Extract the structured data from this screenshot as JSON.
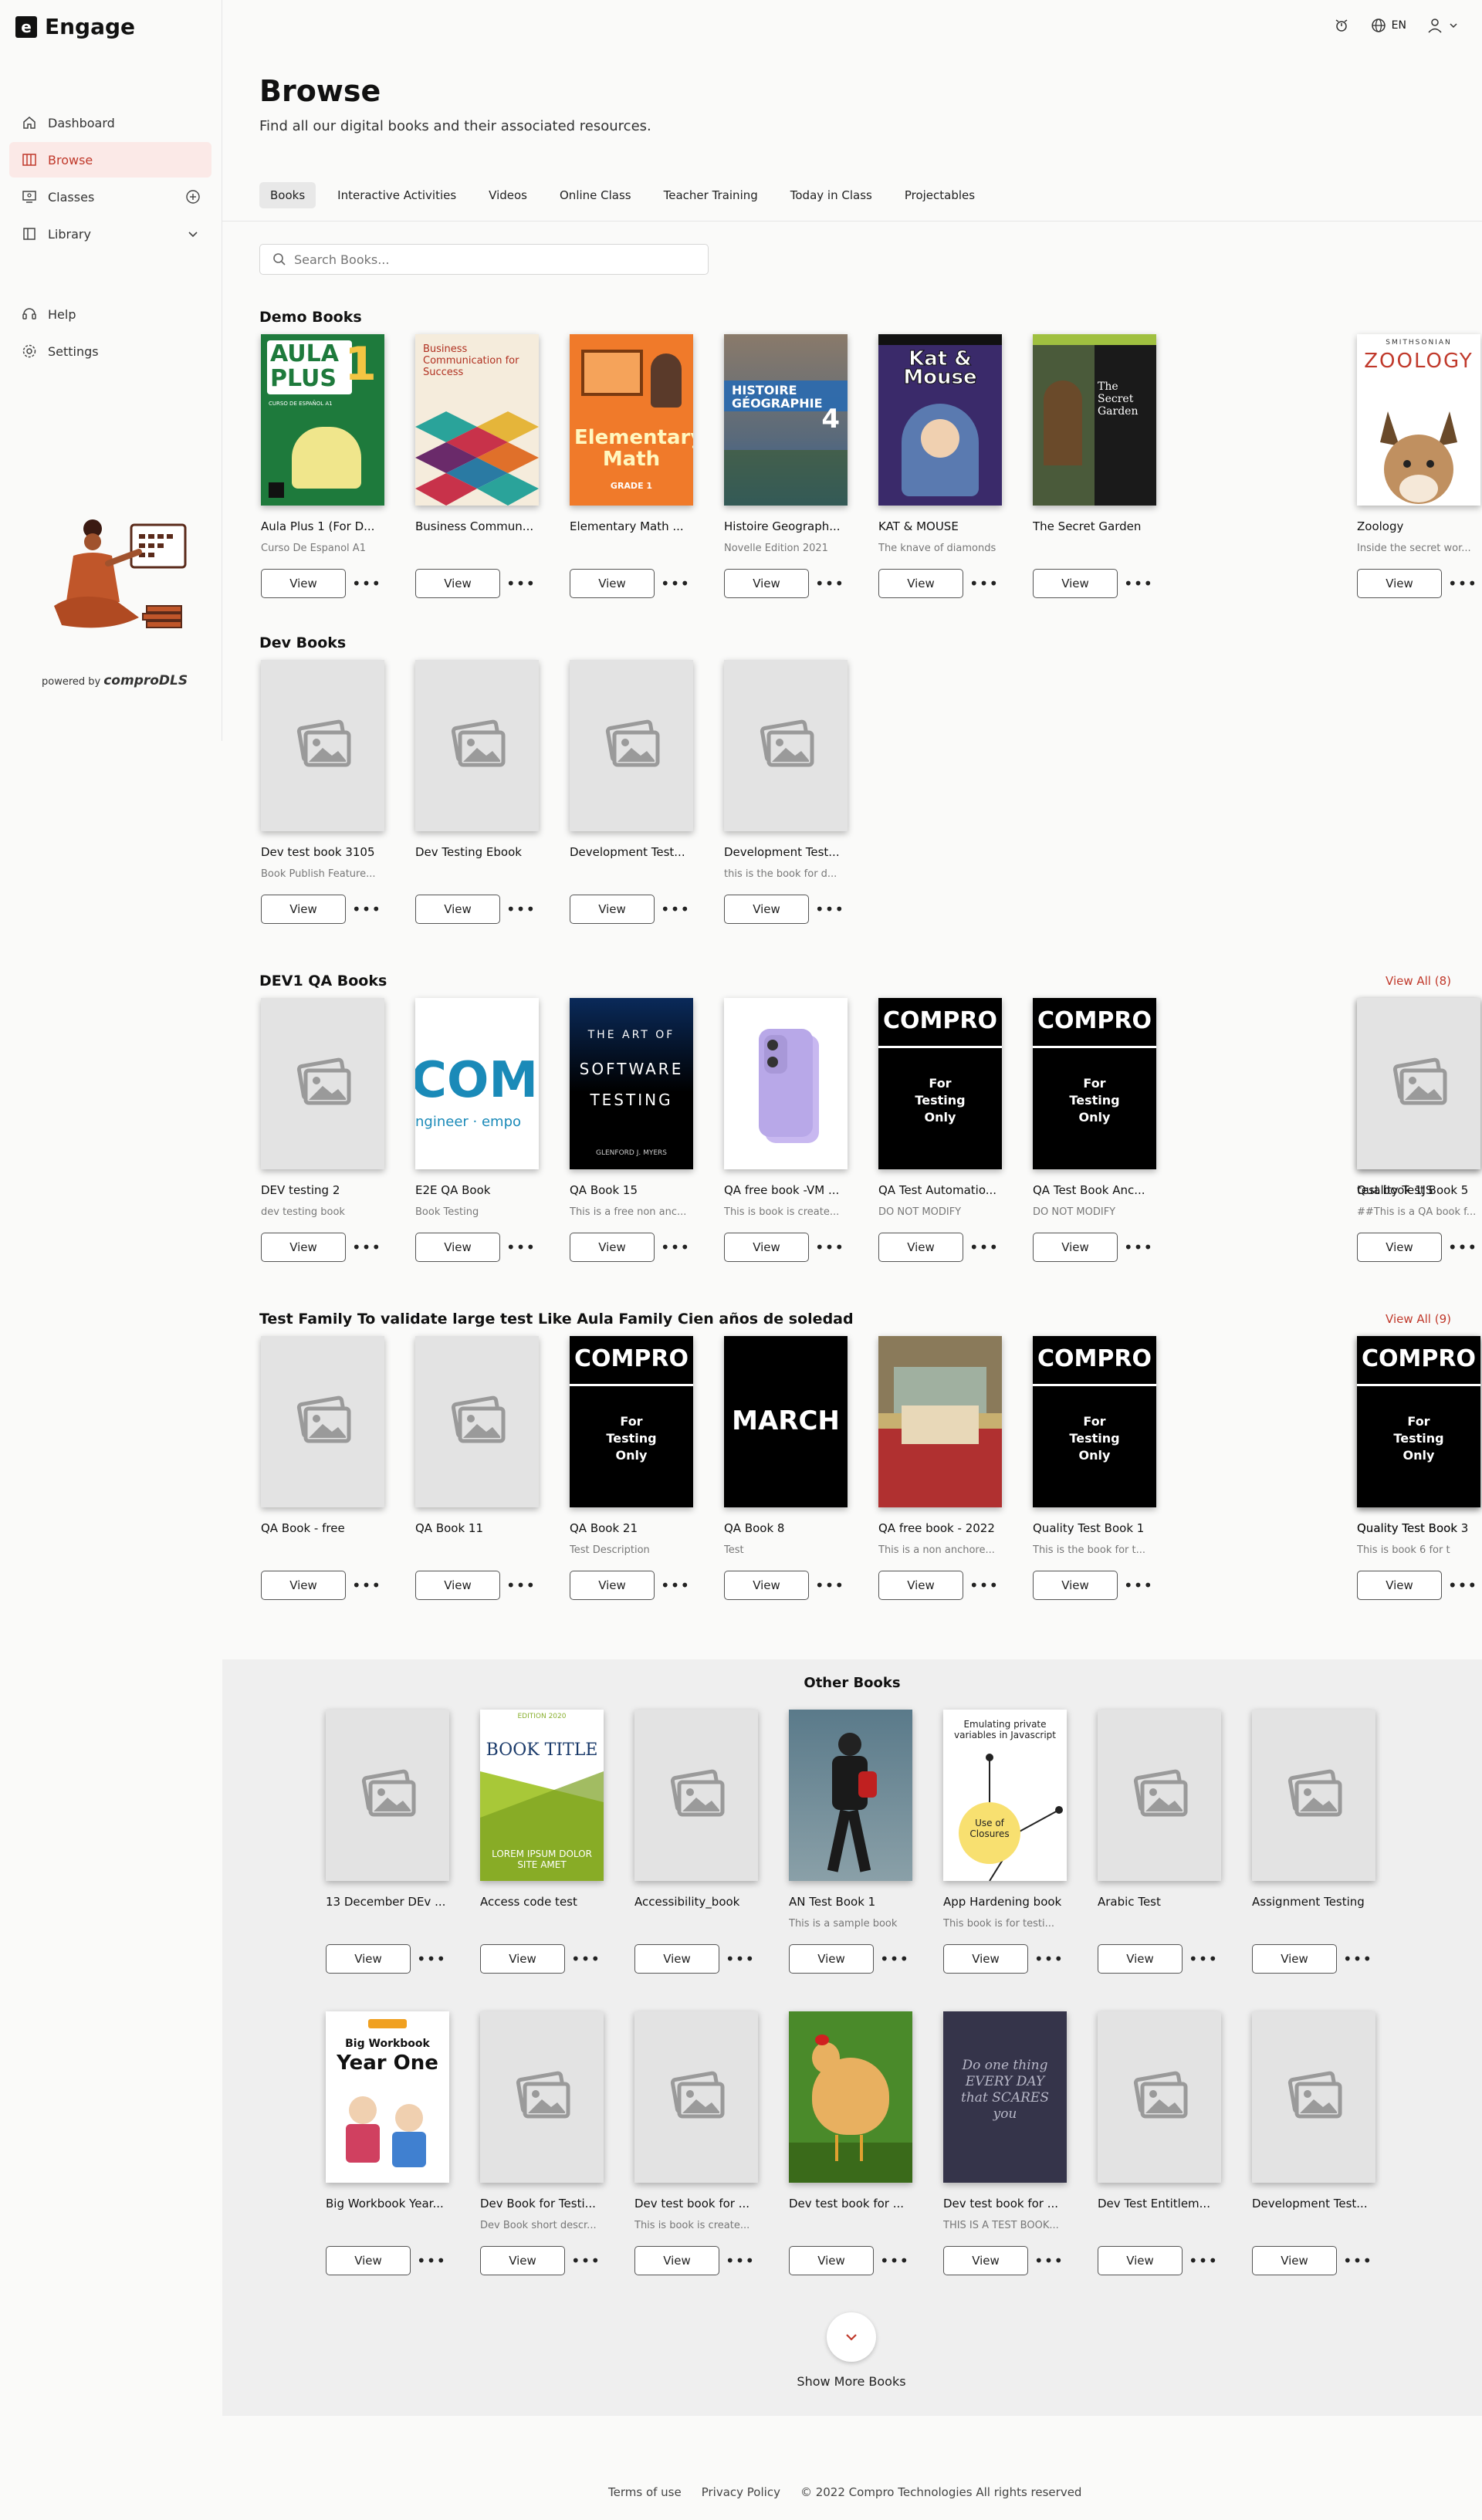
{
  "app": {
    "name": "Engage",
    "logo_letter": "e"
  },
  "topbar": {
    "language": "EN"
  },
  "sidebar": {
    "items": [
      {
        "label": "Dashboard"
      },
      {
        "label": "Browse"
      },
      {
        "label": "Classes"
      },
      {
        "label": "Library"
      },
      {
        "label": "Help"
      },
      {
        "label": "Settings"
      }
    ],
    "powered_by": "powered by",
    "brand": "comproDLS"
  },
  "page": {
    "title": "Browse",
    "subtitle": "Find all our digital books and their associated resources."
  },
  "tabs": [
    "Books",
    "Interactive Activities",
    "Videos",
    "Online Class",
    "Teacher Training",
    "Today in Class",
    "Projectables"
  ],
  "search": {
    "placeholder": "Search Books..."
  },
  "common": {
    "view": "View",
    "more": "•••"
  },
  "sections": [
    {
      "title": "Demo Books",
      "view_all": "",
      "books": [
        {
          "title": "Aula Plus 1 (For D...",
          "sub": "Curso De Espanol A1",
          "cover": "aula"
        },
        {
          "title": "Business Commun...",
          "sub": "",
          "cover": "business"
        },
        {
          "title": "Elementary Math ...",
          "sub": "",
          "cover": "math"
        },
        {
          "title": "Histoire Geograph...",
          "sub": "Novelle Edition 2021",
          "cover": "histoire"
        },
        {
          "title": "KAT & MOUSE",
          "sub": "The knave of diamonds",
          "cover": "kat"
        },
        {
          "title": "The Secret Garden",
          "sub": "",
          "cover": "garden"
        },
        {
          "title": "Zoology",
          "sub": "Inside the secret wor...",
          "cover": "zoology"
        }
      ]
    },
    {
      "title": "Dev Books",
      "view_all": "",
      "books": [
        {
          "title": "Dev test book 3105",
          "sub": "Book Publish Feature...",
          "cover": "placeholder"
        },
        {
          "title": "Dev Testing Ebook",
          "sub": "",
          "cover": "placeholder"
        },
        {
          "title": "Development Test...",
          "sub": "",
          "cover": "placeholder"
        },
        {
          "title": "Development Test...",
          "sub": "this is the book for d...",
          "cover": "placeholder"
        }
      ]
    },
    {
      "title": "DEV1 QA Books",
      "view_all": "View All  (8)",
      "books": [
        {
          "title": "DEV testing 2",
          "sub": "dev testing book",
          "cover": "placeholder"
        },
        {
          "title": "E2E QA Book",
          "sub": "Book Testing",
          "cover": "com"
        },
        {
          "title": "QA Book 15",
          "sub": "This is a free non anc...",
          "cover": "software"
        },
        {
          "title": "QA free book -VM ...",
          "sub": "This is book is create...",
          "cover": "phone"
        },
        {
          "title": "QA Test Automatio...",
          "sub": "DO NOT MODIFY",
          "cover": "compro"
        },
        {
          "title": "QA Test Book Anc...",
          "sub": "DO NOT MODIFY",
          "cover": "compro"
        },
        {
          "title": "Quality Test Book 5",
          "sub": "##This is a QA book f...",
          "cover": "compro"
        },
        {
          "title": "test book 1JS",
          "sub": "",
          "cover": "placeholder"
        }
      ]
    },
    {
      "title": "Test Family To validate large test Like Aula Family Cien años de soledad",
      "view_all": "View All  (9)",
      "books": [
        {
          "title": "QA Book - free",
          "sub": "",
          "cover": "placeholder"
        },
        {
          "title": "QA Book 11",
          "sub": "",
          "cover": "placeholder"
        },
        {
          "title": "QA Book 21",
          "sub": "Test Description",
          "cover": "compro"
        },
        {
          "title": "QA Book 8",
          "sub": "Test",
          "cover": "march"
        },
        {
          "title": "QA free book - 2022",
          "sub": "This is a non anchore...",
          "cover": "painting"
        },
        {
          "title": "Quality Test Book 1",
          "sub": "This is the book for t...",
          "cover": "compro"
        },
        {
          "title": "Quality Test Book 3",
          "sub": "",
          "cover": "check"
        },
        {
          "title": "Quality Test Book",
          "sub": "This is book 6 for t",
          "cover": "compro"
        }
      ]
    }
  ],
  "other_books": {
    "title": "Other Books",
    "rows": [
      [
        {
          "title": "13 December DEv ...",
          "sub": "",
          "cover": "placeholder"
        },
        {
          "title": "Access code test",
          "sub": "",
          "cover": "booktitle"
        },
        {
          "title": "Accessibility_book",
          "sub": "",
          "cover": "placeholder"
        },
        {
          "title": "AN Test Book 1",
          "sub": "This is a sample book",
          "cover": "walker"
        },
        {
          "title": "App Hardening book",
          "sub": "This book is for testi...",
          "cover": "closures"
        },
        {
          "title": "Arabic Test",
          "sub": "",
          "cover": "placeholder"
        },
        {
          "title": "Assignment Testing",
          "sub": "",
          "cover": "placeholder"
        }
      ],
      [
        {
          "title": "Big Workbook Year...",
          "sub": "",
          "cover": "workbook"
        },
        {
          "title": "Dev Book for Testi...",
          "sub": "Dev Book short descr...",
          "cover": "placeholder"
        },
        {
          "title": "Dev test book for ...",
          "sub": "This is book is create...",
          "cover": "placeholder"
        },
        {
          "title": "Dev test book for ...",
          "sub": "",
          "cover": "chicken"
        },
        {
          "title": "Dev test book for ...",
          "sub": "THIS IS A TEST BOOK...",
          "cover": "scares"
        },
        {
          "title": "Dev Test Entitlem...",
          "sub": "",
          "cover": "placeholder"
        },
        {
          "title": "Development Test...",
          "sub": "",
          "cover": "placeholder"
        }
      ]
    ],
    "show_more": "Show More Books"
  },
  "cover_text": {
    "aula_title": "AULA PLUS",
    "aula_num": "1",
    "aula_small": "CURSO DE ESPAÑOL A1",
    "business": "Business Communication for Success",
    "math_title": "Elementary Math",
    "math_grade": "GRADE 1",
    "histoire_title": "HISTOIRE GÉOGRAPHIE",
    "histoire_num": "4",
    "kat_title": "Kat & Mouse",
    "garden_title": "The Secret Garden",
    "zoology_brand": "SMITHSONIAN",
    "zoology_title": "ZOOLOGY",
    "com_big": "COM",
    "com_small": "ngineer · empo",
    "software_line1": "THE ART OF",
    "software_line2": "SOFTWARE",
    "software_line3": "TESTING",
    "software_author": "GLENFORD J. MYERS",
    "compro_big": "COMPRO",
    "compro_small": "For Testing Only",
    "march": "MARCH",
    "booktitle_top": "EDITION 2020",
    "booktitle_big": "BOOK TITLE",
    "booktitle_lorem": "LOREM IPSUM DOLOR SITE AMET",
    "closures_top": "Emulating private variables in Javascript",
    "closures_circle": "Use of Closures",
    "workbook_top": "Big Workbook",
    "workbook_big": "Year One",
    "scares": "Do one thing EVERY DAY that SCARES you"
  },
  "footer": {
    "terms": "Terms of use",
    "privacy": "Privacy Policy",
    "copyright": "© 2022 Compro Technologies All rights reserved"
  }
}
